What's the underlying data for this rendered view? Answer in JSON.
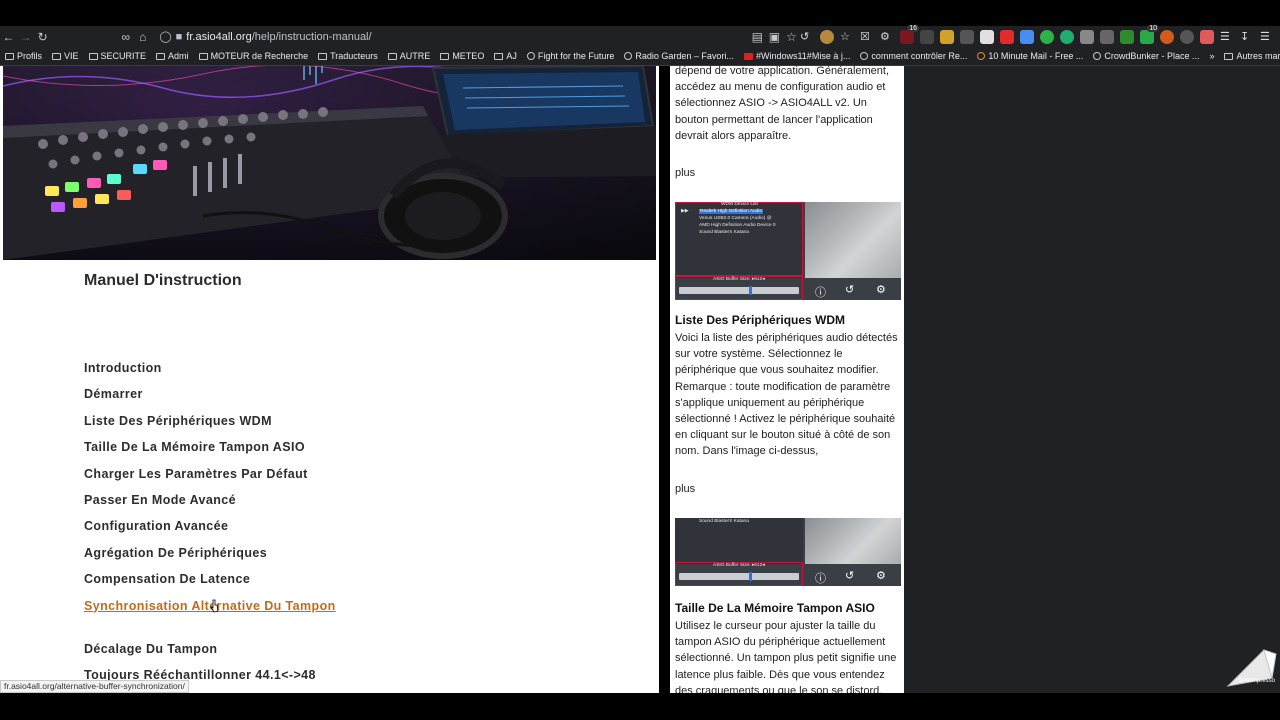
{
  "browser": {
    "url_host": "fr.asio4all.org",
    "url_path": "/help/instruction-manual/",
    "status_url": "fr.asio4all.org/alternative-buffer-synchronization/",
    "bookmarks": [
      "Profils",
      "VIE",
      "SECURITE",
      "Admi",
      "MOTEUR de Recherche",
      "Traducteurs",
      "AUTRE",
      "METEO",
      "AJ",
      "Fight for the Future",
      "Radio Garden – Favori...",
      "#Windows11#Mise à j...",
      "comment contrôler Re...",
      "10 Minute Mail - Free ...",
      "CrowdBunker - Place ..."
    ],
    "bookmarks_other": "Autres marque-pages",
    "extension_badges": [
      "16",
      "10"
    ],
    "colors": {
      "toolbar": "#202124",
      "accent_link": "#c26b1b"
    }
  },
  "left": {
    "page_title": "Manuel D'instruction",
    "toc": [
      "Introduction",
      "Démarrer",
      "Liste Des Périphériques WDM",
      "Taille De La Mémoire Tampon ASIO",
      "Charger Les Paramètres Par Défaut",
      "Passer En Mode Avancé",
      "Configuration Avancée",
      "Agrégation De Périphériques",
      "Compensation De Latence",
      "Synchronisation Alternative Du Tampon",
      "Décalage Du Tampon",
      "Toujours Rééchantillonner 44.1<->48"
    ],
    "active_index": 9
  },
  "right": {
    "para1": "dépend de votre application. Généralement, accédez au menu de configuration audio et sélectionnez ASIO -> ASIO4ALL v2. Un bouton permettant de lancer l'application devrait alors apparaître.",
    "plus1": "plus",
    "shot1": {
      "title": "WDM Device List",
      "devices": [
        "Realtek High Definition Audio",
        "Venus USB2.0 Camera (Audio) @",
        "AMD High Definition Audio Device 0",
        "Sound BlasterX Katana"
      ],
      "buffer_label": "ASIO Buffer Size: ▸512◂"
    },
    "head1": "Liste Des Périphériques WDM",
    "para2": "Voici la liste des périphériques audio détectés sur votre système. Sélectionnez le périphérique que vous souhaitez modifier. Remarque : toute modification de paramètre s'applique uniquement au périphérique sélectionné ! Activez le périphérique souhaité en cliquant sur le bouton situé à côté de son nom. Dans l'image ci-dessus,",
    "plus2": "plus",
    "shot2": {
      "device": "Sound BlasterX Katana",
      "buffer_label": "ASIO Buffer Size: ▸512◂"
    },
    "head2": "Taille De La Mémoire Tampon ASIO",
    "para3": "Utilisez le curseur pour ajuster la taille du tampon ASIO du périphérique actuellement sélectionné. Un tampon plus petit signifie une latence plus faible. Dès que vous entendez des craquements ou que le son se distord, vous"
  },
  "watermark": "Screenpresso"
}
